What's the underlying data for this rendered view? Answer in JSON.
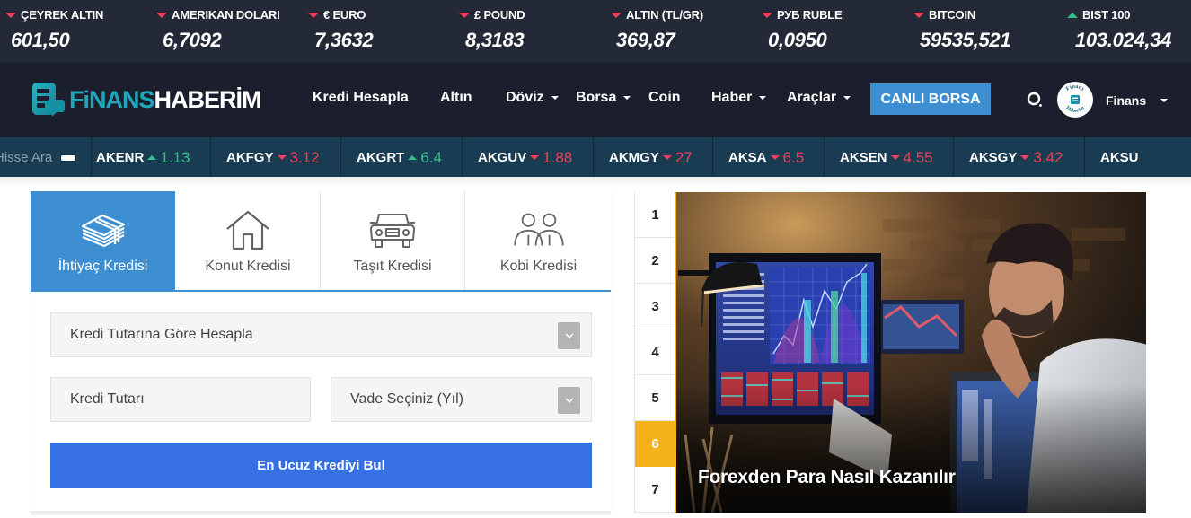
{
  "currencies": [
    {
      "label": "ÇEYREK ALTIN",
      "value": "601,50",
      "trend": "down"
    },
    {
      "label": "AMERIKAN DOLARI",
      "value": "6,7092",
      "trend": "down"
    },
    {
      "label": "€ EURO",
      "value": "7,3632",
      "trend": "down"
    },
    {
      "label": "£ POUND",
      "value": "8,3183",
      "trend": "down"
    },
    {
      "label": "ALTIN (TL/GR)",
      "value": "369,87",
      "trend": "down"
    },
    {
      "label": "РУБ RUBLE",
      "value": "0,0950",
      "trend": "down"
    },
    {
      "label": "BITCOIN",
      "value": "59535,521",
      "trend": "down"
    },
    {
      "label": "BIST 100",
      "value": "103.024,34",
      "trend": "up"
    }
  ],
  "brand": {
    "part1": "FiNANS",
    "part2": "HABERİM"
  },
  "nav": {
    "items": [
      {
        "label": "Kredi Hesapla",
        "dropdown": false
      },
      {
        "label": "Altın",
        "dropdown": false
      },
      {
        "label": "Döviz",
        "dropdown": true
      },
      {
        "label": "Borsa",
        "dropdown": true
      },
      {
        "label": "Coin",
        "dropdown": false
      },
      {
        "label": "Haber",
        "dropdown": true
      },
      {
        "label": "Araçlar",
        "dropdown": true
      }
    ],
    "live_button": "CANLI BORSA",
    "user_name": "Finans",
    "avatar_text_top": "Finans",
    "avatar_text_bottom": "Haberim"
  },
  "ticker": {
    "search_placeholder": "Hisse Ara",
    "stocks": [
      {
        "symbol": "AKENR",
        "value": "1.13",
        "trend": "up"
      },
      {
        "symbol": "AKFGY",
        "value": "3.12",
        "trend": "down"
      },
      {
        "symbol": "AKGRT",
        "value": "6.4",
        "trend": "up"
      },
      {
        "symbol": "AKGUV",
        "value": "1.88",
        "trend": "down"
      },
      {
        "symbol": "AKMGY",
        "value": "27",
        "trend": "down"
      },
      {
        "symbol": "AKSA",
        "value": "6.5",
        "trend": "down"
      },
      {
        "symbol": "AKSEN",
        "value": "4.55",
        "trend": "down"
      },
      {
        "symbol": "AKSGY",
        "value": "3.42",
        "trend": "down"
      },
      {
        "symbol": "AKSU",
        "value": "",
        "trend": ""
      }
    ]
  },
  "calculator": {
    "tabs": [
      {
        "label": "İhtiyaç Kredisi",
        "icon": "money-stack-icon",
        "active": true
      },
      {
        "label": "Konut Kredisi",
        "icon": "house-icon",
        "active": false
      },
      {
        "label": "Taşıt Kredisi",
        "icon": "car-icon",
        "active": false
      },
      {
        "label": "Kobi Kredisi",
        "icon": "people-icon",
        "active": false
      }
    ],
    "calc_type_select": "Kredi Tutarına Göre Hesapla",
    "amount_placeholder": "Kredi Tutarı",
    "term_select": "Vade Seçiniz (Yıl)",
    "submit_label": "En Ucuz Krediyi Bul"
  },
  "headlines": {
    "numbers": [
      "1",
      "2",
      "3",
      "4",
      "5",
      "6",
      "7"
    ],
    "active_index": 6,
    "current_title": "Forexden Para Nasıl Kazanılır"
  },
  "colors": {
    "topbar_bg": "#242938",
    "nav_bg": "#1b1f2d",
    "ticker_bg": "#1a3c52",
    "accent_blue": "#3d8fd1",
    "button_blue": "#3770e3",
    "up_green": "#33c08f",
    "down_red": "#f0405a",
    "active_yellow": "#f6b21a"
  }
}
